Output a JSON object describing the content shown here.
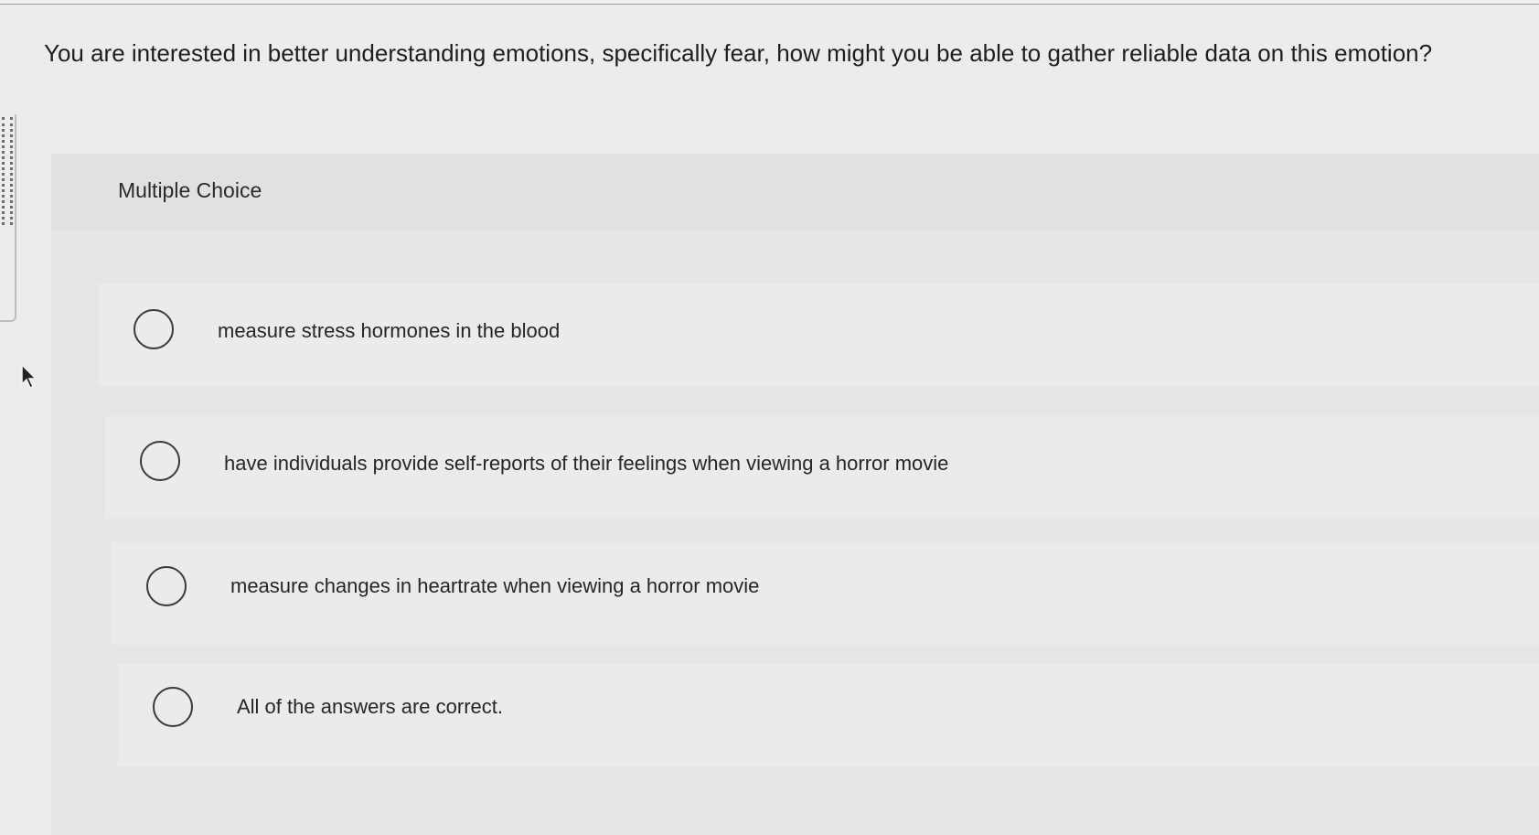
{
  "question": {
    "text": "You are interested in better understanding emotions, specifically fear, how might you be able to gather reliable data on this emotion?"
  },
  "quiz": {
    "type_label": "Multiple Choice",
    "options": [
      {
        "label": "measure stress hormones in the blood",
        "selected": false
      },
      {
        "label": "have individuals provide self-reports of their feelings when viewing a horror movie",
        "selected": false
      },
      {
        "label": "measure changes in heartrate when viewing a horror movie",
        "selected": false
      },
      {
        "label": "All of the answers are correct.",
        "selected": false
      }
    ]
  },
  "icons": {
    "radio": "radio-button-icon",
    "cursor": "mouse-pointer-icon"
  },
  "colors": {
    "background": "#ececeb",
    "panel": "#e6e6e5",
    "radio_border": "#3a3a3a",
    "text": "#1f1f1f"
  }
}
